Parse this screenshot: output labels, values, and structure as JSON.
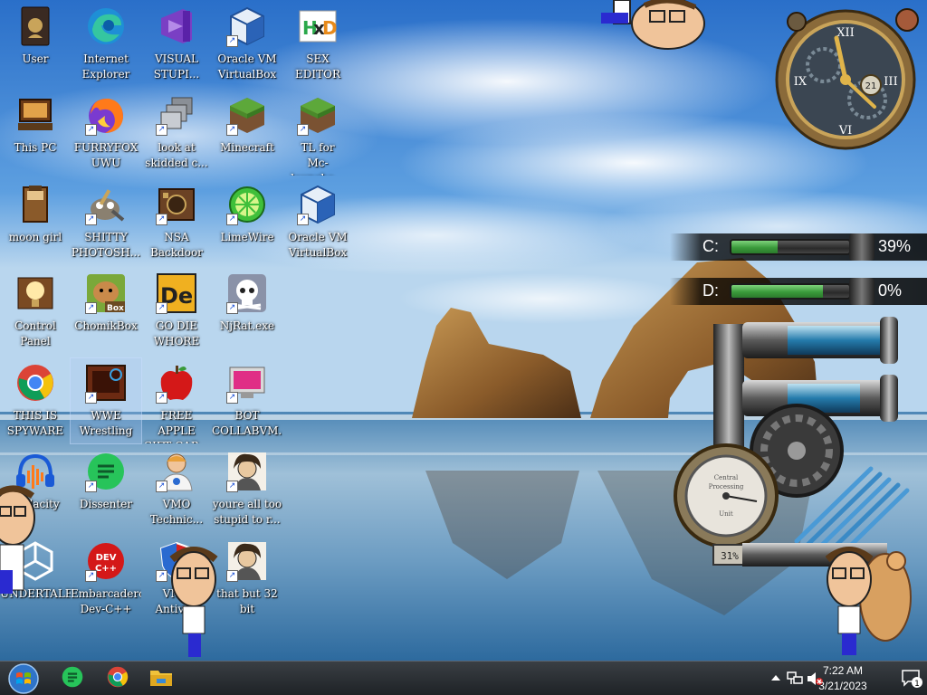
{
  "desktop": {
    "icons": [
      {
        "label": "User",
        "icon": "user-folder-icon"
      },
      {
        "label": "Internet\nExplorer",
        "icon": "edge-icon"
      },
      {
        "label": "VISUAL\nSTUPI...",
        "icon": "visual-studio-icon"
      },
      {
        "label": "Oracle VM\nVirtualBox",
        "icon": "virtualbox-icon"
      },
      {
        "label": "SEX\nEDITOR",
        "icon": "hxd-icon"
      },
      {
        "label": "This PC",
        "icon": "computer-icon"
      },
      {
        "label": "FURRYFOX\nUWU",
        "icon": "firefox-icon"
      },
      {
        "label": "look at\nskidded c...",
        "icon": "stacked-windows-icon"
      },
      {
        "label": "Minecraft",
        "icon": "grass-block-icon"
      },
      {
        "label": "TL for\nMc-launche...",
        "icon": "grass-block-icon"
      },
      {
        "label": "moon girl",
        "icon": "book-icon"
      },
      {
        "label": "SHITTY\nPHOTOSH...",
        "icon": "gimp-icon"
      },
      {
        "label": "NSA\nBackdoor",
        "icon": "wood-box-icon"
      },
      {
        "label": "LimeWire",
        "icon": "limewire-icon"
      },
      {
        "label": "Oracle VM\nVirtualBox",
        "icon": "virtualbox-icon"
      },
      {
        "label": "Control Panel",
        "icon": "lightbulb-icon"
      },
      {
        "label": "ChomikBox",
        "icon": "hamster-box-icon"
      },
      {
        "label": "GO DIE\nWHORE",
        "icon": "de-icon"
      },
      {
        "label": "NjRat.exe",
        "icon": "skull-icon"
      },
      {
        "label": "THIS IS\nSPYWARE",
        "icon": "chrome-icon"
      },
      {
        "label": "WWE\nWrestling",
        "icon": "wwe-icon"
      },
      {
        "label": "FREE APPLE\nGIFT CAR...",
        "icon": "apple-icon"
      },
      {
        "label": "BOT\nCOLLABVM...",
        "icon": "pink-monitor-icon"
      },
      {
        "label": "Audacity",
        "icon": "audacity-icon"
      },
      {
        "label": "Dissenter",
        "icon": "dissenter-icon"
      },
      {
        "label": "VMO\nTechnic...",
        "icon": "technician-icon"
      },
      {
        "label": "youre all too\nstupid to r...",
        "icon": "portrait-icon"
      },
      {
        "label": "UNDERTALE",
        "icon": "unity-icon"
      },
      {
        "label": "Embarcadero\nDev-C++",
        "icon": "devcpp-icon"
      },
      {
        "label": "VMO\nAntivi...",
        "icon": "shield-icon"
      },
      {
        "label": "that but 32\nbit",
        "icon": "portrait-icon"
      }
    ]
  },
  "widgets": {
    "clock": {
      "date_number": "21"
    },
    "drives": [
      {
        "label": "C:",
        "percent_text": "39%",
        "fraction": 0.39
      },
      {
        "label": "D:",
        "percent_text": "0%",
        "fraction": 0.0
      }
    ],
    "gauge": {
      "dial_top": "Central",
      "dial_mid": "Processing",
      "dial_bottom": "Unit",
      "readout": "31%"
    }
  },
  "taskbar": {
    "start_label": "Start",
    "pinned": [
      {
        "name": "dissenter",
        "icon": "dissenter-icon"
      },
      {
        "name": "chrome",
        "icon": "chrome-icon"
      },
      {
        "name": "file-explorer",
        "icon": "folder-icon"
      }
    ],
    "clock": {
      "time": "7:22 AM",
      "date": "3/21/2023"
    },
    "notification_count": "1"
  },
  "colors": {
    "taskbar": "#2a2e33",
    "drive_fill": "#3a9a3b",
    "sky": "#3b7fd0"
  }
}
